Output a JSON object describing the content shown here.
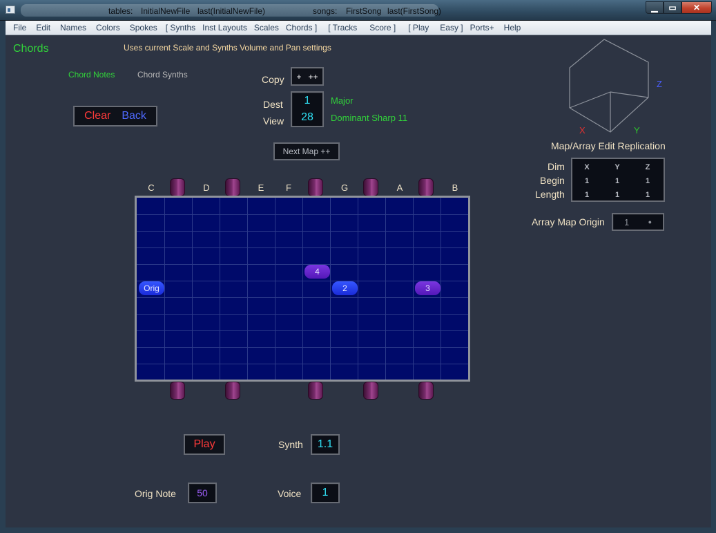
{
  "titlebar": {
    "tables_label": "tables:",
    "tables_value": "InitialNewFile",
    "tables_last": "last(InitialNewFile)",
    "songs_label": "songs:",
    "songs_value": "FirstSong",
    "songs_last": "last(FirstSong)",
    "min": "▁",
    "max": "▭",
    "close": "✕"
  },
  "menu": [
    "File",
    "Edit",
    "Names",
    "Colors",
    "Spokes",
    "[  Synths",
    "Inst Layouts",
    "Scales",
    "Chords  ]",
    "[  Tracks",
    "Score  ]",
    "[  Play",
    "Easy  ]",
    "Ports+",
    "Help"
  ],
  "page": {
    "heading": "Chords",
    "subtitle": "Uses current Scale and Synths Volume and Pan settings",
    "tab_chord_notes": "Chord Notes",
    "tab_chord_synths": "Chord Synths",
    "clear": "Clear",
    "back": "Back",
    "copy_label": "Copy",
    "copy_value": "+   ++",
    "dest_label": "Dest",
    "dest_value": "1",
    "dest_name": "Major",
    "view_label": "View",
    "view_value": "28",
    "view_name": "Dominant Sharp 11",
    "next_map": "Next Map ++"
  },
  "axes": {
    "x": "X",
    "y": "Y",
    "z": "Z"
  },
  "replication": {
    "title": "Map/Array Edit Replication",
    "row_labels": [
      "Dim",
      "Begin",
      "Length"
    ],
    "columns": [
      "X",
      "Y",
      "Z"
    ],
    "begin": [
      "1",
      "1",
      "1"
    ],
    "length": [
      "1",
      "1",
      "1"
    ],
    "origin_label": "Array Map Origin",
    "origin_value": "1",
    "origin_dot": "●"
  },
  "grid": {
    "notes": [
      "C",
      "D",
      "E",
      "F",
      "G",
      "A",
      "B"
    ],
    "chips": [
      "Orig",
      "2",
      "3",
      "4"
    ]
  },
  "bottom": {
    "play": "Play",
    "synth_label": "Synth",
    "synth_value": "1.1",
    "orig_note_label": "Orig Note",
    "orig_note_value": "50",
    "voice_label": "Voice",
    "voice_value": "1"
  },
  "colors": {
    "background": "#2d3443",
    "grid": "#000a6a",
    "accent_green": "#31d33a",
    "accent_cyan": "#2fe1f5",
    "clear_red": "#ff3a3a",
    "back_blue": "#4f6aff"
  }
}
